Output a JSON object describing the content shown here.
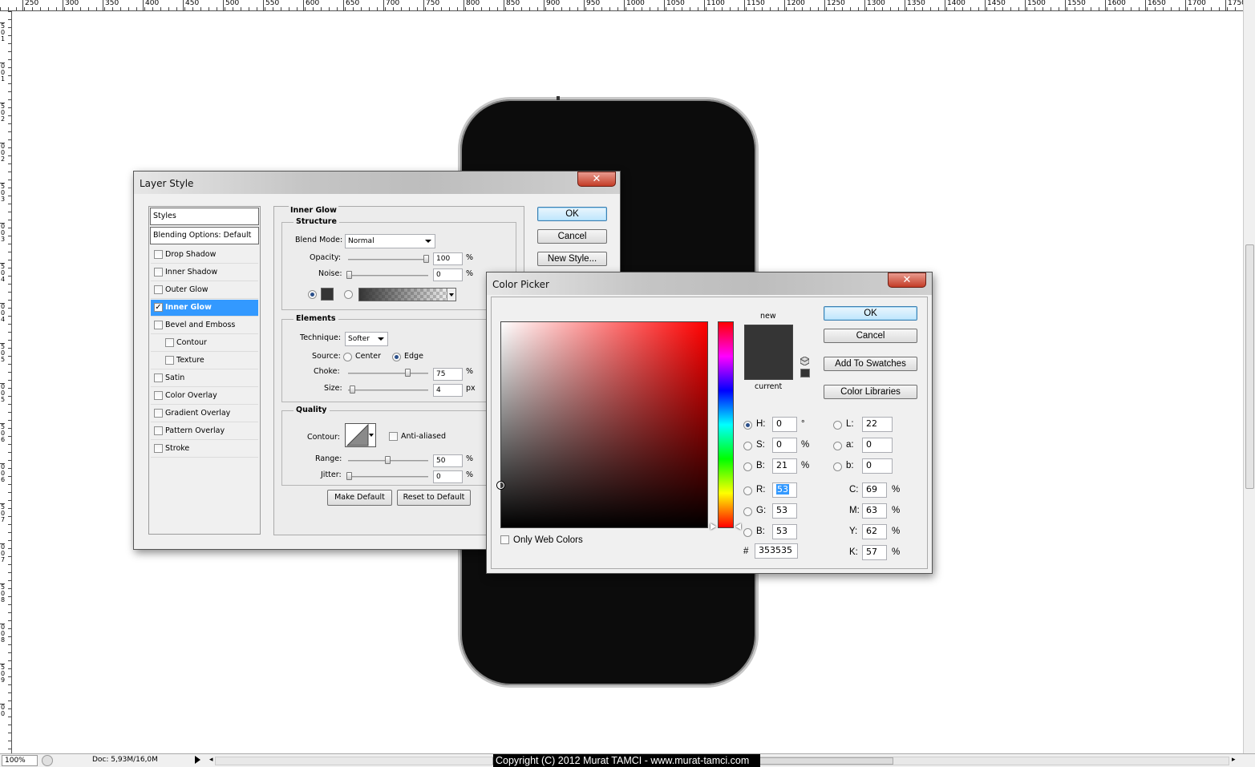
{
  "ruler": {
    "top_ticks": [
      "250",
      "300",
      "350",
      "400",
      "450",
      "500",
      "550",
      "600",
      "650",
      "700",
      "750",
      "800",
      "850",
      "900",
      "950",
      "1000",
      "1050",
      "1100",
      "1150",
      "1200",
      "1250",
      "1300",
      "1350",
      "1400",
      "1450",
      "1500",
      "1550",
      "1600",
      "1650",
      "1700",
      "1750"
    ],
    "left_ticks": [
      "5",
      "0",
      "1",
      "0",
      "0",
      "1",
      "5",
      "0",
      "2",
      "0",
      "0",
      "2",
      "5",
      "0",
      "3",
      "0",
      "0",
      "3",
      "5",
      "0",
      "4",
      "0",
      "0",
      "4",
      "5",
      "0",
      "5",
      "0",
      "0",
      "5",
      "5",
      "0",
      "6",
      "0",
      "0",
      "6",
      "5",
      "0",
      "7",
      "0",
      "0",
      "7",
      "5",
      "0",
      "8",
      "0",
      "0",
      "8",
      "5",
      "0",
      "9",
      "0",
      "0"
    ]
  },
  "status": {
    "zoom": "100%",
    "doc": "Doc: 5,93M/16,0M",
    "copyright": "Copyright (C) 2012 Murat TAMCI - www.murat-tamci.com"
  },
  "layer_style": {
    "title": "Layer Style",
    "close": "✕",
    "styles_header": "Styles",
    "blending": "Blending Options: Default",
    "items": [
      {
        "label": "Drop Shadow",
        "checked": false,
        "sub": false,
        "selected": false
      },
      {
        "label": "Inner Shadow",
        "checked": false,
        "sub": false,
        "selected": false
      },
      {
        "label": "Outer Glow",
        "checked": false,
        "sub": false,
        "selected": false
      },
      {
        "label": "Inner Glow",
        "checked": true,
        "sub": false,
        "selected": true
      },
      {
        "label": "Bevel and Emboss",
        "checked": false,
        "sub": false,
        "selected": false
      },
      {
        "label": "Contour",
        "checked": false,
        "sub": true,
        "selected": false
      },
      {
        "label": "Texture",
        "checked": false,
        "sub": true,
        "selected": false
      },
      {
        "label": "Satin",
        "checked": false,
        "sub": false,
        "selected": false
      },
      {
        "label": "Color Overlay",
        "checked": false,
        "sub": false,
        "selected": false
      },
      {
        "label": "Gradient Overlay",
        "checked": false,
        "sub": false,
        "selected": false
      },
      {
        "label": "Pattern Overlay",
        "checked": false,
        "sub": false,
        "selected": false
      },
      {
        "label": "Stroke",
        "checked": false,
        "sub": false,
        "selected": false
      }
    ],
    "panel_title": "Inner Glow",
    "structure": {
      "title": "Structure",
      "blend_mode_label": "Blend Mode:",
      "blend_mode": "Normal",
      "opacity_label": "Opacity:",
      "opacity": "100",
      "noise_label": "Noise:",
      "noise": "0",
      "pct": "%",
      "glow_color": "#353535"
    },
    "elements": {
      "title": "Elements",
      "technique_label": "Technique:",
      "technique": "Softer",
      "source_label": "Source:",
      "center": "Center",
      "edge": "Edge",
      "choke_label": "Choke:",
      "choke": "75",
      "size_label": "Size:",
      "size": "4",
      "pct": "%",
      "px": "px"
    },
    "quality": {
      "title": "Quality",
      "contour_label": "Contour:",
      "anti_aliased": "Anti-aliased",
      "range_label": "Range:",
      "range": "50",
      "jitter_label": "Jitter:",
      "jitter": "0",
      "pct": "%"
    },
    "make_default": "Make Default",
    "reset_default": "Reset to Default",
    "ok": "OK",
    "cancel": "Cancel",
    "new_style": "New Style..."
  },
  "color_picker": {
    "title": "Color Picker",
    "close": "✕",
    "new_label": "new",
    "current_label": "current",
    "ok": "OK",
    "cancel": "Cancel",
    "add_swatches": "Add To Swatches",
    "color_libraries": "Color Libraries",
    "only_web": "Only Web Colors",
    "hash": "#",
    "hex": "353535",
    "hsb": [
      {
        "label": "H:",
        "value": "0",
        "unit": "°",
        "on": true
      },
      {
        "label": "S:",
        "value": "0",
        "unit": "%",
        "on": false
      },
      {
        "label": "B:",
        "value": "21",
        "unit": "%",
        "on": false
      }
    ],
    "rgb": [
      {
        "label": "R:",
        "value": "53",
        "unit": "",
        "on": false
      },
      {
        "label": "G:",
        "value": "53",
        "unit": "",
        "on": false
      },
      {
        "label": "B:",
        "value": "53",
        "unit": "",
        "on": false
      }
    ],
    "lab": [
      {
        "label": "L:",
        "value": "22"
      },
      {
        "label": "a:",
        "value": "0"
      },
      {
        "label": "b:",
        "value": "0"
      }
    ],
    "cmyk": [
      {
        "label": "C:",
        "value": "69",
        "unit": "%"
      },
      {
        "label": "M:",
        "value": "63",
        "unit": "%"
      },
      {
        "label": "Y:",
        "value": "62",
        "unit": "%"
      },
      {
        "label": "K:",
        "value": "57",
        "unit": "%"
      }
    ],
    "new_color": "#353535",
    "current_color": "#353535",
    "hue_color": "#ff0000"
  }
}
